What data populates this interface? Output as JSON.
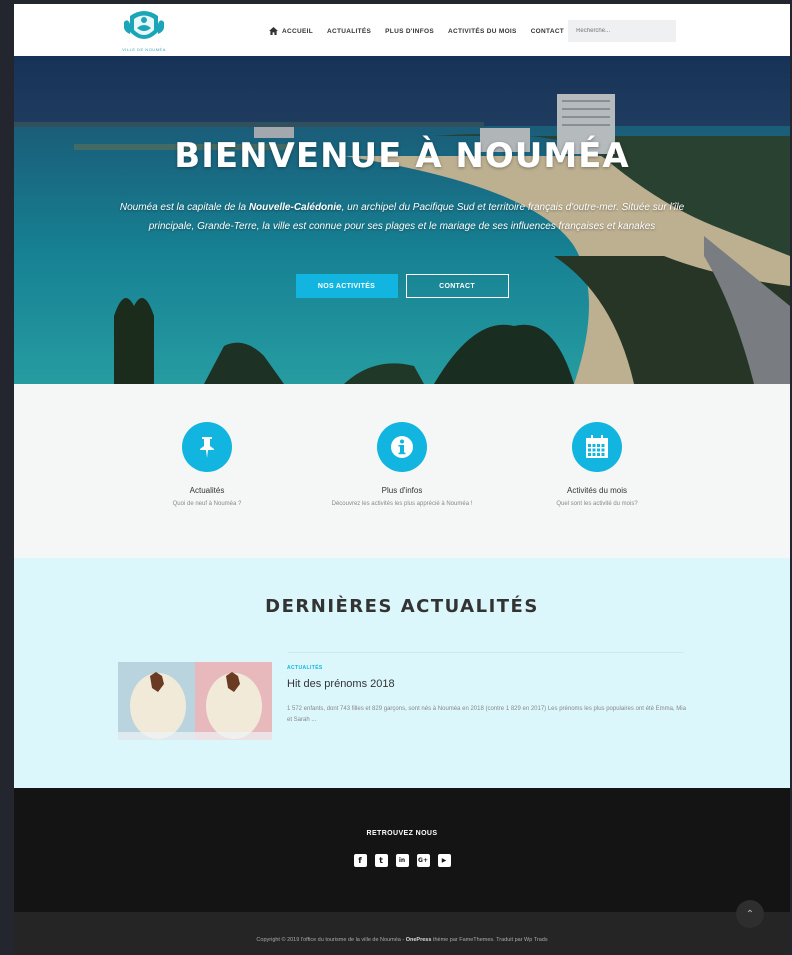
{
  "header": {
    "logo_caption": "VILLE DE NOUMÉA",
    "nav": [
      {
        "label": "ACCUEIL",
        "icon": "home-icon"
      },
      {
        "label": "ACTUALITÉS"
      },
      {
        "label": "PLUS D'INFOS"
      },
      {
        "label": "ACTIVITÉS DU MOIS"
      },
      {
        "label": "CONTACT"
      }
    ],
    "search_placeholder": "Recherche..."
  },
  "hero": {
    "title": "BIENVENUE À NOUMÉA",
    "text_prefix": "Nouméa est la capitale de la ",
    "text_bold": "Nouvelle-Calédonie",
    "text_suffix": ", un archipel du Pacifique Sud et territoire français d'outre-mer. Située sur l'île principale, Grande-Terre, la ville est connue pour ses plages et le mariage de ses influences françaises et kanakes",
    "btn_primary": "NOS ACTIVITÉS",
    "btn_secondary": "CONTACT"
  },
  "features": [
    {
      "title": "Actualités",
      "desc": "Quoi de neuf à Nouméa ?",
      "icon": "pin-icon"
    },
    {
      "title": "Plus d'infos",
      "desc": "Découvrez les activités les plus apprécié à Nouméa !",
      "icon": "info-icon"
    },
    {
      "title": "Activités du mois",
      "desc": "Quel sont les activité du mois?",
      "icon": "calendar-icon"
    }
  ],
  "news": {
    "section_title": "DERNIÈRES ACTUALITÉS",
    "post": {
      "category": "ACTUALITÉS",
      "title": "Hit des prénoms 2018",
      "excerpt": "1 572 enfants, dont 743 filles et 829 garçons, sont nés à Nouméa en 2018 (contre 1 829 en 2017) Les prénoms les plus populaires ont été Emma, Mia et Sarah ..."
    }
  },
  "footer": {
    "follow_title": "RETROUVEZ NOUS",
    "socials": [
      {
        "icon": "facebook-icon",
        "glyph": "f"
      },
      {
        "icon": "twitter-icon",
        "glyph": "t"
      },
      {
        "icon": "linkedin-icon",
        "glyph": "in"
      },
      {
        "icon": "google-plus-icon",
        "glyph": "G+"
      },
      {
        "icon": "youtube-icon",
        "glyph": "▶"
      }
    ],
    "copyright_text": "Copyright © 2019 l'office du tourisme de la ville de Nouméa - ",
    "copyright_brand": "OnePress",
    "copyright_suffix": " thème par FameThemes. Traduit par Wp Trads"
  },
  "colors": {
    "accent": "#12b5df",
    "news_bg": "#dcf7fc",
    "footer_bg": "#141414"
  }
}
